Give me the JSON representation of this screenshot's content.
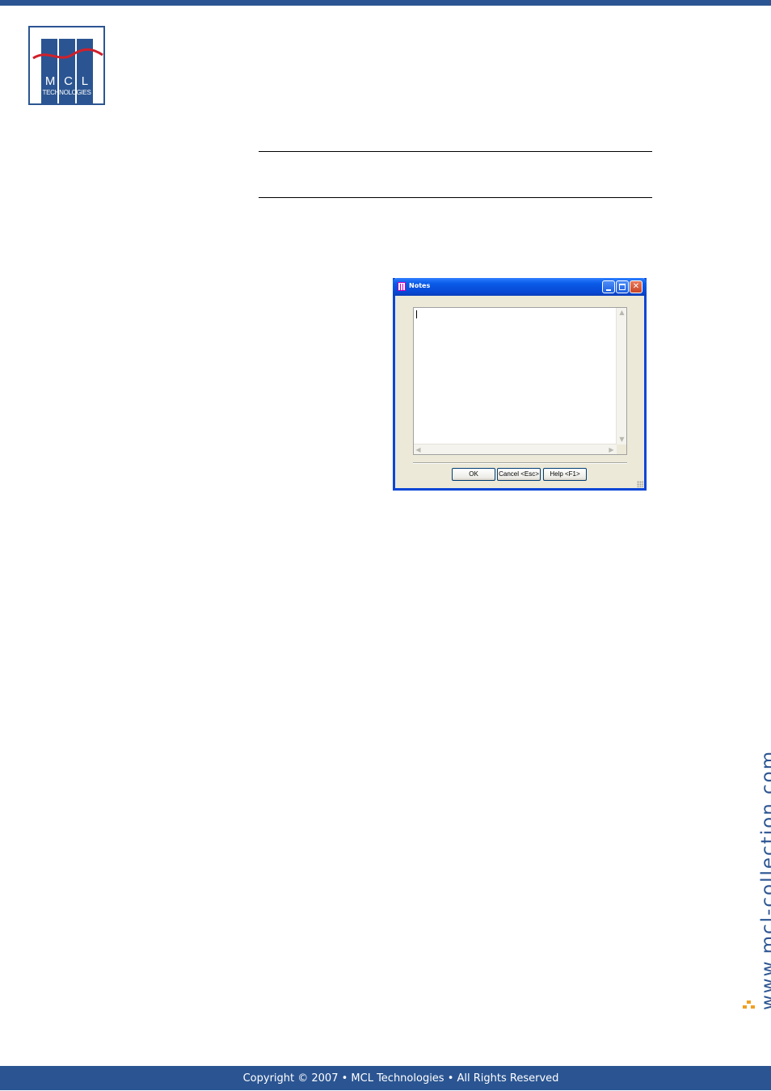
{
  "logo": {
    "letters": [
      "M",
      "C",
      "L"
    ],
    "subtitle": "TECHNOLOGIES"
  },
  "dialog": {
    "title": "Notes",
    "notes_value": "",
    "buttons": {
      "ok": "OK",
      "cancel": "Cancel <Esc>",
      "help": "Help <F1>"
    }
  },
  "side_url": "www.mcl-collection.com",
  "footer": {
    "copyright": "Copyright © 2007 • MCL Technologies • All Rights Reserved"
  },
  "colors": {
    "brand_blue": "#2b5592",
    "accent_orange": "#f0a020",
    "titlebar_blue": "#0a5ce8"
  }
}
